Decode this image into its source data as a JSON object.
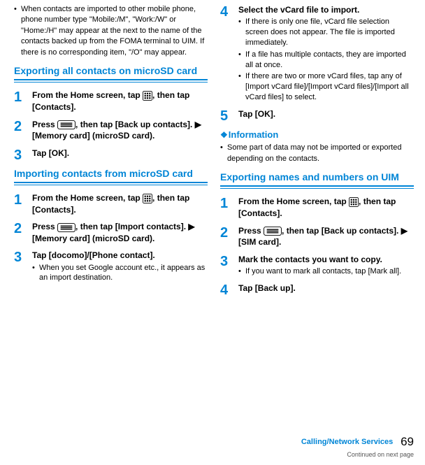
{
  "left": {
    "intro_note": "When contacts are imported to other mobile phone, phone number type \"Mobile:/M\", \"Work:/W\" or \"Home:/H\" may appear at the next to the name of the contacts backed up from the FOMA terminal to UIM. If there is no corresponding item, \"/O\" may appear.",
    "section1": {
      "heading": "Exporting all contacts on microSD card",
      "steps": {
        "s1": "From the Home screen, tap [GRID], then tap [Contacts].",
        "s2": "Press [MENU], then tap [Back up contacts]. ▶ [Memory card] (microSD card).",
        "s3": "Tap [OK]."
      }
    },
    "section2": {
      "heading": "Importing contacts from microSD card",
      "steps": {
        "s1": "From the Home screen, tap [GRID], then tap [Contacts].",
        "s2": "Press [MENU], then tap [Import contacts]. ▶ [Memory card] (microSD card).",
        "s3": "Tap [docomo]/[Phone contact].",
        "s3_sub": "When you set Google account etc., it appears as an import destination."
      }
    }
  },
  "right": {
    "s4": {
      "title": "Select the vCard file to import.",
      "b1": "If there is only one file, vCard file selection screen does not appear. The file is imported immediately.",
      "b2": "If a file has multiple contacts, they are imported all at once.",
      "b3": "If there are two or more vCard files, tap any of [Import vCard file]/[Import vCard files]/[Import all vCard files] to select."
    },
    "s5": "Tap [OK].",
    "info_heading": "Information",
    "info_note": "Some part of data may not be imported or exported depending on the contacts.",
    "section3": {
      "heading": "Exporting names and numbers on UIM",
      "steps": {
        "s1": "From the Home screen, tap [GRID], then tap [Contacts].",
        "s2": "Press [MENU], then tap [Back up contacts]. ▶ [SIM card].",
        "s3": "Mark the contacts you want to copy.",
        "s3_sub": "If you want to mark all contacts, tap [Mark all].",
        "s4": "Tap [Back up]."
      }
    }
  },
  "footer": {
    "link": "Calling/Network Services",
    "page": "69",
    "next": "Continued on next page"
  }
}
